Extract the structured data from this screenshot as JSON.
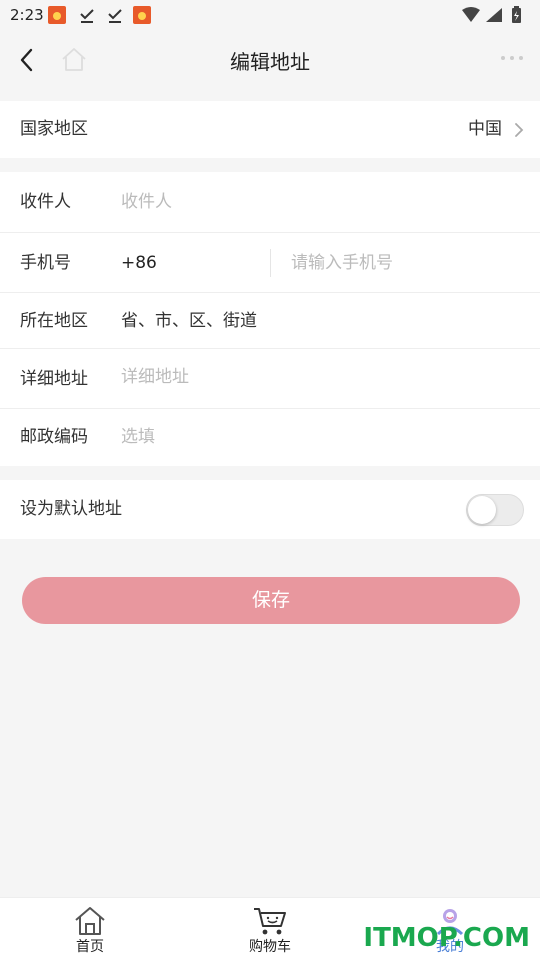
{
  "status_bar": {
    "time": "2:23"
  },
  "nav": {
    "title": "编辑地址"
  },
  "country": {
    "label": "国家地区",
    "value": "中国"
  },
  "form": {
    "recipient": {
      "label": "收件人",
      "placeholder": "收件人"
    },
    "phone": {
      "label": "手机号",
      "prefix": "+86",
      "placeholder": "请输入手机号"
    },
    "region": {
      "label": "所在地区",
      "value": "省、市、区、街道"
    },
    "address": {
      "label": "详细地址",
      "placeholder": "详细地址"
    },
    "postcode": {
      "label": "邮政编码",
      "placeholder": "选填"
    }
  },
  "default_address": {
    "label": "设为默认地址",
    "enabled": false
  },
  "save_button": {
    "label": "保存"
  },
  "tabs": [
    {
      "label": "首页",
      "icon": "home-icon"
    },
    {
      "label": "购物车",
      "icon": "cart-icon"
    },
    {
      "label": "我的",
      "icon": "profile-icon"
    }
  ],
  "watermark": "ITMOP.COM",
  "colors": {
    "accent": "#e8979e",
    "tab_active": "#4a7fd6",
    "watermark": "#1aa84f"
  }
}
